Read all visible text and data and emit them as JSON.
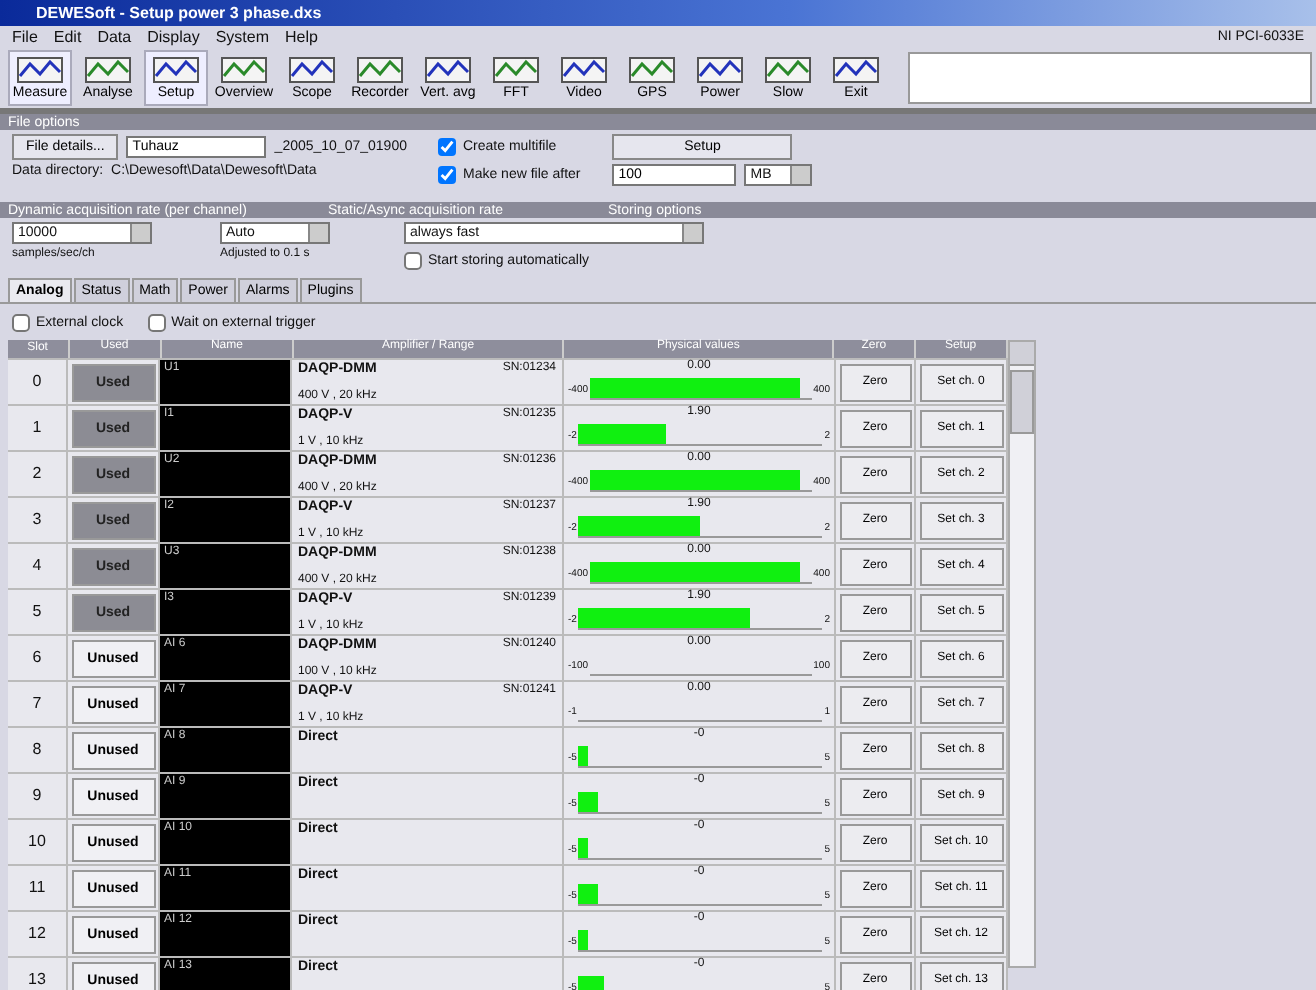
{
  "window": {
    "title": "DEWESoft - Setup power 3 phase.dxs"
  },
  "menu": [
    "File",
    "Edit",
    "Data",
    "Display",
    "System",
    "Help"
  ],
  "device": "NI PCI-6033E",
  "toolbar": [
    {
      "label": "Measure",
      "selected": true
    },
    {
      "label": "Analyse",
      "selected": false
    },
    {
      "label": "Setup",
      "selected": true
    },
    {
      "label": "Overview",
      "selected": false
    },
    {
      "label": "Scope",
      "selected": false
    },
    {
      "label": "Recorder",
      "selected": false
    },
    {
      "label": "Vert. avg",
      "selected": false
    },
    {
      "label": "FFT",
      "selected": false
    },
    {
      "label": "Video",
      "selected": false
    },
    {
      "label": "GPS",
      "selected": false
    },
    {
      "label": "Power",
      "selected": false
    },
    {
      "label": "Slow",
      "selected": false
    },
    {
      "label": "Exit",
      "selected": false
    }
  ],
  "file": {
    "section": "File options",
    "details_button": "File details...",
    "name": "Tuhauz",
    "suffix": "_2005_10_07_01900",
    "dir_label": "Data directory:",
    "dir": "C:\\Dewesoft\\Data\\Dewesoft\\Data",
    "multifile": {
      "label": "Create multifile",
      "checked": true
    },
    "setup_button": "Setup",
    "newfile": {
      "label": "Make new file after",
      "checked": true
    },
    "size": "100",
    "unit": "MB"
  },
  "rates": {
    "sections": [
      "Dynamic acquisition rate (per channel)",
      "Static/Async acquisition rate",
      "Storing options"
    ],
    "dynamic": "10000",
    "dynamic_unit": "samples/sec/ch",
    "static": "Auto",
    "static_note": "Adjusted to 0.1 s",
    "storing": "always fast",
    "autostart": {
      "label": "Start storing automatically",
      "checked": false
    }
  },
  "tabs": [
    {
      "label": "Analog",
      "selected": true
    },
    {
      "label": "Status",
      "selected": false
    },
    {
      "label": "Math",
      "selected": false
    },
    {
      "label": "Power",
      "selected": false
    },
    {
      "label": "Alarms",
      "selected": false
    },
    {
      "label": "Plugins",
      "selected": false
    }
  ],
  "options": [
    {
      "label": "External clock",
      "checked": false
    },
    {
      "label": "Wait on external trigger",
      "checked": false
    }
  ],
  "table": {
    "columns": [
      "Slot",
      "Used",
      "Name",
      "Amplifier / Range",
      "Physical values",
      "Zero",
      "Setup"
    ],
    "rows": [
      {
        "index": "0",
        "used": true,
        "used_label": "Used",
        "name": "U1",
        "amp": "DAQP-DMM",
        "sn": "SN:01234",
        "range": "400 V , 20 kHz",
        "value": "0.00",
        "min": "-400",
        "max": "400",
        "level": 0.95,
        "zero": "Zero",
        "setup": "Set ch. 0"
      },
      {
        "index": "1",
        "used": true,
        "used_label": "Used",
        "name": "I1",
        "amp": "DAQP-V",
        "sn": "SN:01235",
        "range": "1 V , 10 kHz",
        "value": "1.90",
        "min": "-2",
        "max": "2",
        "level": 0.36,
        "zero": "Zero",
        "setup": "Set ch. 1"
      },
      {
        "index": "2",
        "used": true,
        "used_label": "Used",
        "name": "U2",
        "amp": "DAQP-DMM",
        "sn": "SN:01236",
        "range": "400 V , 20 kHz",
        "value": "0.00",
        "min": "-400",
        "max": "400",
        "level": 0.95,
        "zero": "Zero",
        "setup": "Set ch. 2"
      },
      {
        "index": "3",
        "used": true,
        "used_label": "Used",
        "name": "I2",
        "amp": "DAQP-V",
        "sn": "SN:01237",
        "range": "1 V , 10 kHz",
        "value": "1.90",
        "min": "-2",
        "max": "2",
        "level": 0.5,
        "zero": "Zero",
        "setup": "Set ch. 3"
      },
      {
        "index": "4",
        "used": true,
        "used_label": "Used",
        "name": "U3",
        "amp": "DAQP-DMM",
        "sn": "SN:01238",
        "range": "400 V , 20 kHz",
        "value": "0.00",
        "min": "-400",
        "max": "400",
        "level": 0.95,
        "zero": "Zero",
        "setup": "Set ch. 4"
      },
      {
        "index": "5",
        "used": true,
        "used_label": "Used",
        "name": "I3",
        "amp": "DAQP-V",
        "sn": "SN:01239",
        "range": "1 V , 10 kHz",
        "value": "1.90",
        "min": "-2",
        "max": "2",
        "level": 0.7,
        "zero": "Zero",
        "setup": "Set ch. 5"
      },
      {
        "index": "6",
        "used": false,
        "used_label": "Unused",
        "name": "AI 6",
        "amp": "DAQP-DMM",
        "sn": "SN:01240",
        "range": "100 V , 10 kHz",
        "value": "0.00",
        "min": "-100",
        "max": "100",
        "zero": "Zero",
        "setup": "Set ch. 6"
      },
      {
        "index": "7",
        "used": false,
        "used_label": "Unused",
        "name": "AI 7",
        "amp": "DAQP-V",
        "sn": "SN:01241",
        "range": "1 V , 10 kHz",
        "value": "0.00",
        "min": "-1",
        "max": "1",
        "zero": "Zero",
        "setup": "Set ch. 7"
      },
      {
        "index": "8",
        "used": false,
        "used_label": "Unused",
        "name": "AI 8",
        "amp": "Direct",
        "value": "-0",
        "min": "-5",
        "max": "5",
        "level": 0.04,
        "zero": "Zero",
        "setup": "Set ch. 8"
      },
      {
        "index": "9",
        "used": false,
        "used_label": "Unused",
        "name": "AI 9",
        "amp": "Direct",
        "value": "-0",
        "min": "-5",
        "max": "5",
        "level": 0.08,
        "zero": "Zero",
        "setup": "Set ch. 9"
      },
      {
        "index": "10",
        "used": false,
        "used_label": "Unused",
        "name": "AI 10",
        "amp": "Direct",
        "value": "-0",
        "min": "-5",
        "max": "5",
        "level": 0.04,
        "zero": "Zero",
        "setup": "Set ch. 10"
      },
      {
        "index": "11",
        "used": false,
        "used_label": "Unused",
        "name": "AI 11",
        "amp": "Direct",
        "value": "-0",
        "min": "-5",
        "max": "5",
        "level": 0.08,
        "zero": "Zero",
        "setup": "Set ch. 11"
      },
      {
        "index": "12",
        "used": false,
        "used_label": "Unused",
        "name": "AI 12",
        "amp": "Direct",
        "value": "-0",
        "min": "-5",
        "max": "5",
        "level": 0.04,
        "zero": "Zero",
        "setup": "Set ch. 12"
      },
      {
        "index": "13",
        "used": false,
        "used_label": "Unused",
        "name": "AI 13",
        "amp": "Direct",
        "value": "-0",
        "min": "-5",
        "max": "5",
        "level": 0.1,
        "zero": "Zero",
        "setup": "Set ch. 13"
      }
    ]
  }
}
